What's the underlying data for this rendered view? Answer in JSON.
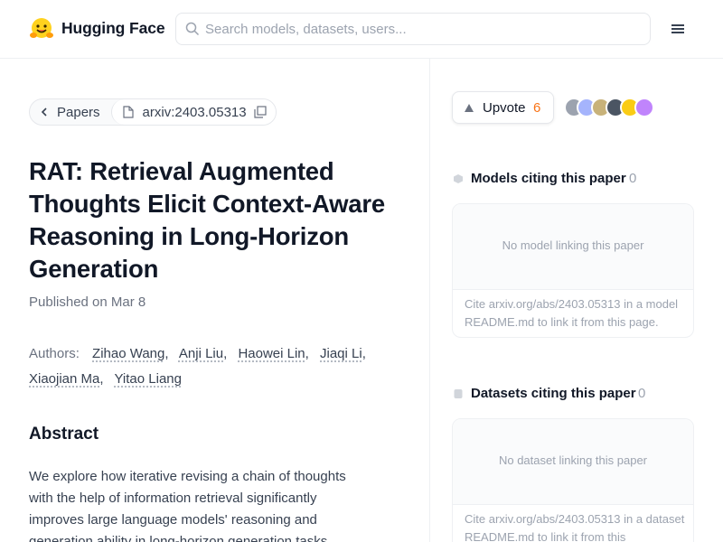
{
  "header": {
    "brand": "Hugging Face",
    "search_placeholder": "Search models, datasets, users...",
    "logo_icon": "hugging-face-logo",
    "menu_icon": "hamburger-menu-icon"
  },
  "breadcrumb": {
    "back_label": "Papers",
    "paper_id": "arxiv:2403.05313"
  },
  "paper": {
    "title": "RAT: Retrieval Augmented Thoughts Elicit Context-Aware Reasoning in Long-Horizon Generation",
    "published": "Published on Mar 8",
    "authors_label": "Authors:",
    "authors": [
      "Zihao Wang",
      "Anji Liu",
      "Haowei Lin",
      "Jiaqi Li",
      "Xiaojian Ma",
      "Yitao Liang"
    ],
    "abstract_heading": "Abstract",
    "abstract_lines": [
      "We explore how iterative revising a chain of thoughts",
      "with the help of information retrieval significantly",
      "improves large language models' reasoning and",
      "generation ability in long-horizon generation tasks,"
    ]
  },
  "sidebar": {
    "upvote_label": "Upvote",
    "upvote_count": "6",
    "upvote_color": "#f97316",
    "avatar_colors": [
      "#9ca3af",
      "#a5b4fc",
      "#d4b483",
      "#6b7280",
      "#facc15",
      "#c084fc"
    ],
    "models": {
      "title": "Models citing this paper",
      "count": "0",
      "empty": "No model linking this paper",
      "note": "Cite arxiv.org/abs/2403.05313 in a model README.md to link it from this page."
    },
    "datasets": {
      "title": "Datasets citing this paper",
      "count": "0",
      "empty": "No dataset linking this paper",
      "note": "Cite arxiv.org/abs/2403.05313 in a dataset README.md to link it from this"
    }
  }
}
